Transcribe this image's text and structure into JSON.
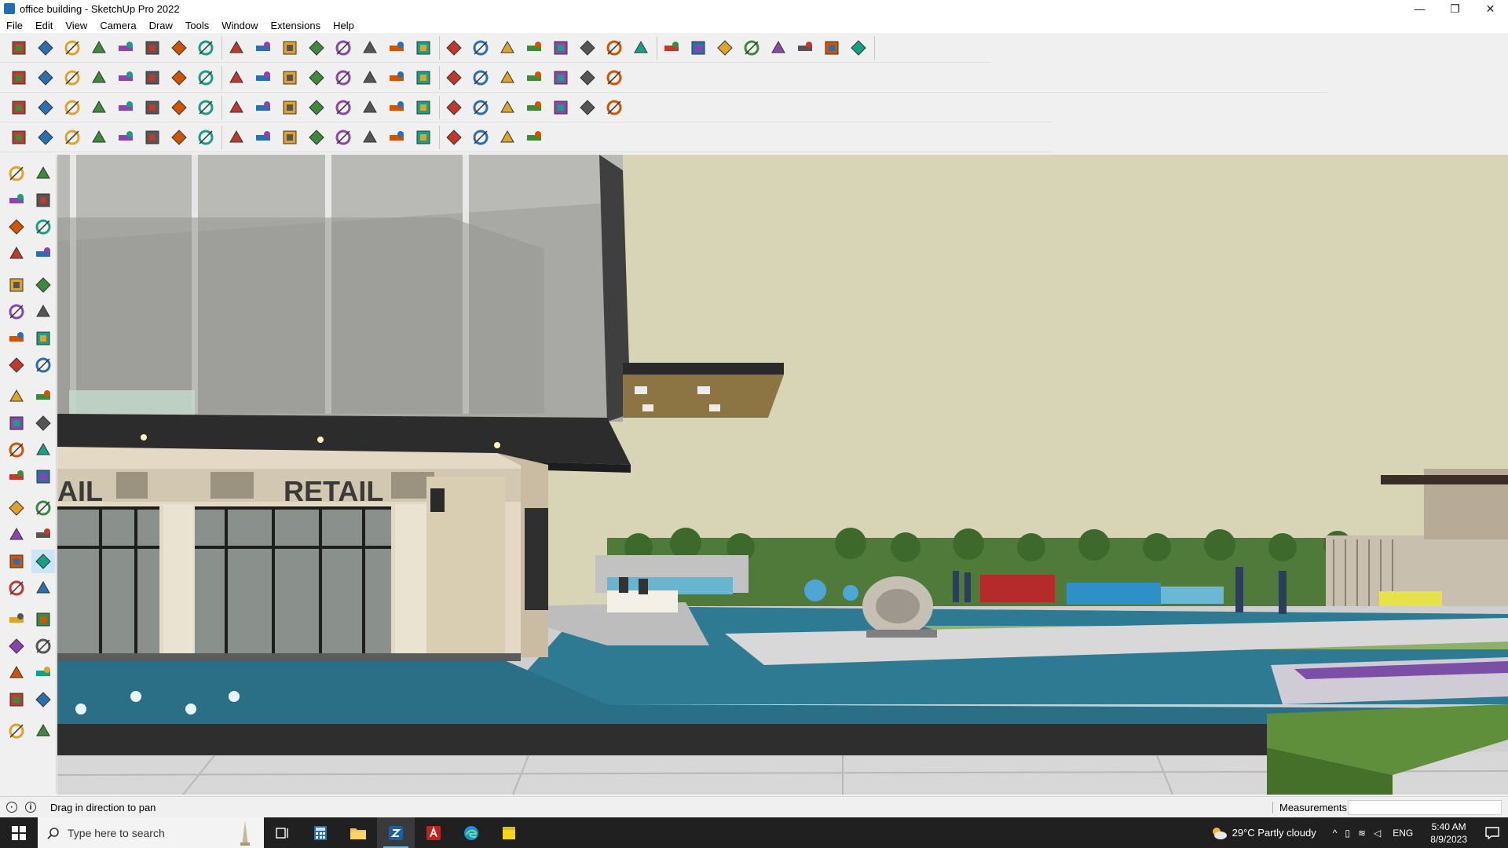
{
  "window": {
    "title": "office building - SketchUp Pro 2022",
    "controls": {
      "minimize": "—",
      "restore": "❐",
      "close": "✕"
    }
  },
  "menu": [
    "File",
    "Edit",
    "View",
    "Camera",
    "Draw",
    "Tools",
    "Window",
    "Extensions",
    "Help"
  ],
  "toolbars": {
    "row1": [
      "zoom-icon",
      "select-icon",
      "eraser-icon",
      "line-icon",
      "lasso-icon",
      "rectangle-icon",
      "pushpull-icon",
      "followme-icon",
      "move-icon",
      "rotate-icon",
      "scale-icon",
      "tape-icon",
      "text-icon",
      "paint-icon",
      "orbit-icon",
      "pan-icon",
      "zoom-window-icon",
      "zoom-extents-icon",
      "components-icon",
      "styles-icon",
      "layers-icon",
      "scenes-icon",
      "warehouse-icon",
      "extensions-icon",
      "section-icon",
      "axes-icon",
      "measure-icon",
      "import-icon",
      "export-icon",
      "undo-icon",
      "redo-icon",
      "hand-icon"
    ],
    "row2": [
      "iso-view-icon",
      "top-view-icon",
      "front-view-icon",
      "extrude-icon",
      "roof-icon",
      "weld-icon",
      "wall-icon",
      "door-icon",
      "window-icon",
      "house-icon",
      "stairs-icon",
      "terrain-icon",
      "pencil-icon",
      "spline-icon",
      "circle-icon",
      "polygon-icon",
      "ellipse-icon",
      "arc-icon",
      "bezier-icon",
      "loft-icon",
      "curve-icon",
      "material-icon",
      "render-icon"
    ],
    "row3": [
      "plane-icon",
      "slab-icon",
      "beam-icon",
      "column-icon",
      "bend-icon",
      "knife-icon",
      "grid-icon",
      "pipe-icon",
      "cross-icon",
      "plus-icon",
      "weld2-icon",
      "cone-icon",
      "triangle-icon",
      "curl-icon",
      "joint-icon",
      "array-icon",
      "split-icon",
      "tree-icon",
      "link-icon",
      "cube-icon",
      "tile-icon",
      "frame-icon",
      "mesh-icon"
    ],
    "row4": [
      "vertex-icon",
      "spline-edit-icon",
      "fillet-icon",
      "chamfer-icon",
      "shell-icon",
      "sweep-icon",
      "twist-icon",
      "extrude2-icon",
      "bevel-icon",
      "offset-icon",
      "mirror-icon",
      "trim-icon",
      "stretch-icon",
      "fence-icon",
      "railing-icon",
      "truss-icon",
      "roof-tile-icon",
      "louver-icon",
      "step-icon",
      "hatch-icon"
    ]
  },
  "left_tools": [
    "select-icon",
    "orbit-icon",
    "paint-icon",
    "eraser-icon",
    "components-icon",
    "tape-icon",
    "line-icon",
    "freehand-icon",
    "rectangle-icon",
    "rotated-rect-icon",
    "circle-icon",
    "polygon-icon",
    "arc-icon",
    "pie-icon",
    "arc3-icon",
    "sector-icon",
    "move-icon",
    "pushpull-icon",
    "rotate-icon",
    "followme-icon",
    "scale-icon",
    "offset-icon",
    "tape-measure-icon",
    "dimension-icon",
    "protractor-icon",
    "text-icon",
    "axes-icon",
    "3d-text-icon",
    "orbit2-icon",
    "pan-icon",
    "zoom-icon",
    "zoom-window-icon",
    "zoom-extents-icon",
    "previous-icon",
    "walk-icon",
    "look-around-icon",
    "footprint-icon",
    "position-camera-icon",
    "section-plane-icon",
    "section-display-icon",
    "layers-icon",
    "outliner-icon"
  ],
  "viewport": {
    "sign_left": "AIL",
    "sign_main": "RETAIL",
    "colors": {
      "sky": "#d8d5b6",
      "water": "#2f7a93",
      "glass": "#a9aaa6",
      "stone": "#d9cdb8"
    }
  },
  "status": {
    "hint": "Drag in direction to pan",
    "measurements_label": "Measurements",
    "measurements_value": ""
  },
  "taskbar": {
    "search_placeholder": "Type here to search",
    "weather": "29°C  Partly cloudy",
    "lang": "ENG",
    "time": "5:40 AM",
    "date": "8/9/2023"
  }
}
